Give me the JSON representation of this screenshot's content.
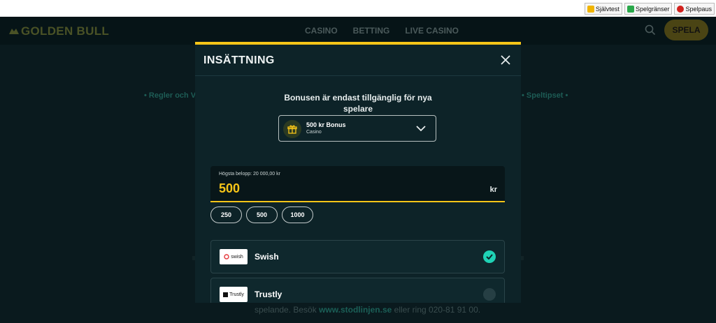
{
  "rg_bar": {
    "items": [
      {
        "label": "Självtest",
        "icon": "selftest-icon",
        "color": "#f0b400"
      },
      {
        "label": "Spelgränser",
        "icon": "limits-icon",
        "color": "#2aa84a"
      },
      {
        "label": "Spelpaus",
        "icon": "pause-icon",
        "color": "#d2221e"
      }
    ]
  },
  "header": {
    "logo": "GOLDEN BULL",
    "nav": [
      "CASINO",
      "BETTING",
      "LIVE CASINO"
    ],
    "cta": "SPELA"
  },
  "background": {
    "left_links": "• Regler och V",
    "right_links": "• Speltipset •",
    "footer_text": "spelande. Besök",
    "footer_link": "www.stodlinjen.se",
    "footer_tail": "eller ring 020-81 91 00."
  },
  "modal": {
    "title": "INSÄTTNING",
    "bonus_notice_line1": "Bonusen är endast tillgänglig för nya",
    "bonus_notice_line2": "spelare",
    "bonus_select": {
      "title": "500 kr Bonus",
      "subtitle": "Casino"
    },
    "amount": {
      "label": "Högsta belopp: 20 000,00 kr",
      "value": "500",
      "currency": "kr"
    },
    "quick_amounts": [
      "250",
      "500",
      "1000"
    ],
    "methods": [
      {
        "name": "Swish",
        "logo": "swish",
        "selected": true
      },
      {
        "name": "Trustly",
        "logo": "Trustly",
        "selected": false
      }
    ]
  },
  "colors": {
    "accent": "#f7c518",
    "check": "#1fd2b5",
    "modal_bg": "#0d2328"
  }
}
